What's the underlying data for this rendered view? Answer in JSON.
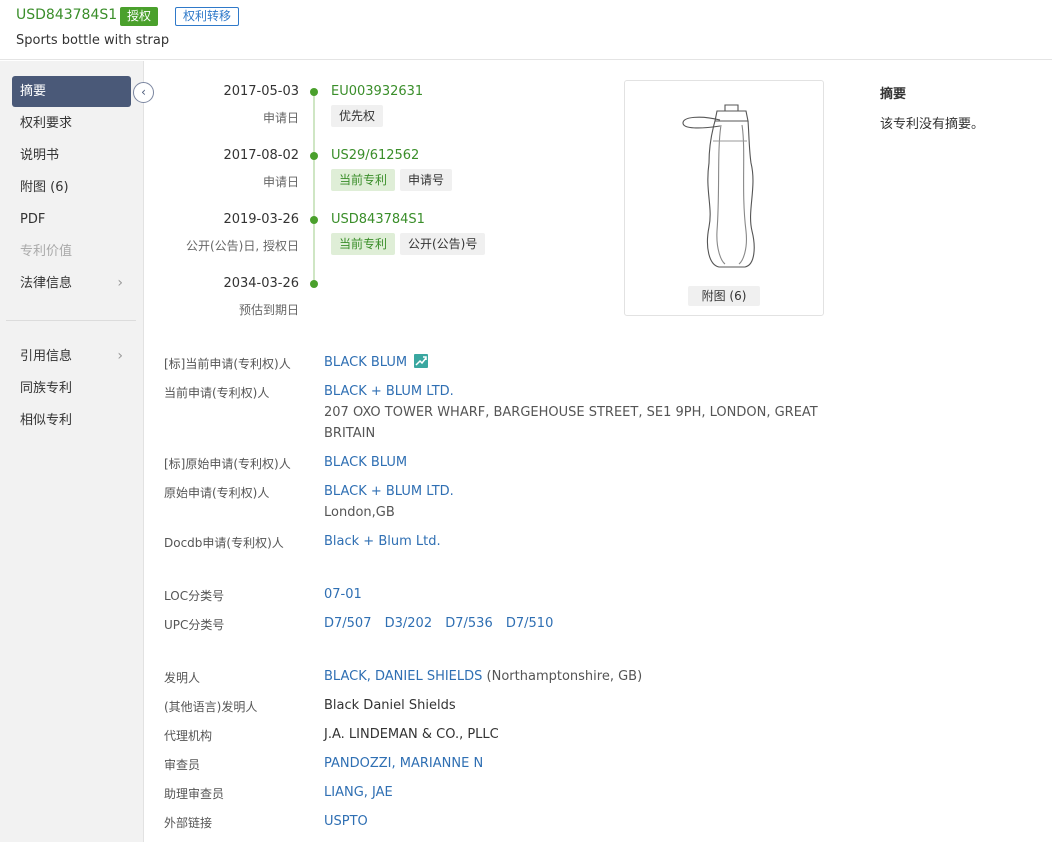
{
  "header": {
    "patent_number": "USD843784S1",
    "status_badge": "授权",
    "transfer_badge": "权利转移",
    "title": "Sports bottle with strap"
  },
  "sidebar": {
    "items": [
      {
        "label": "摘要",
        "active": true
      },
      {
        "label": "权利要求"
      },
      {
        "label": "说明书"
      },
      {
        "label": "附图 (6)"
      },
      {
        "label": "PDF"
      },
      {
        "label": "专利价值",
        "disabled": true
      },
      {
        "label": "法律信息",
        "arrow": "›"
      }
    ],
    "items2": [
      {
        "label": "引用信息",
        "arrow": "›"
      },
      {
        "label": "同族专利"
      },
      {
        "label": "相似专利"
      }
    ],
    "collapse_icon": "‹"
  },
  "timeline": [
    {
      "date": "2017-05-03",
      "label": "申请日",
      "number": "EU003932631",
      "tags": [
        {
          "text": "优先权",
          "style": "gray"
        }
      ]
    },
    {
      "date": "2017-08-02",
      "label": "申请日",
      "number": "US29/612562",
      "tags": [
        {
          "text": "当前专利",
          "style": "green"
        },
        {
          "text": "申请号",
          "style": "gray"
        }
      ]
    },
    {
      "date": "2019-03-26",
      "label": "公开(公告)日, 授权日",
      "number": "USD843784S1",
      "tags": [
        {
          "text": "当前专利",
          "style": "green"
        },
        {
          "text": "公开(公告)号",
          "style": "gray"
        }
      ]
    },
    {
      "date": "2034-03-26",
      "label": "预估到期日",
      "number": "",
      "tags": []
    }
  ],
  "image_panel": {
    "caption": "附图 (6)"
  },
  "abstract": {
    "title": "摘要",
    "text": "该专利没有摘要。"
  },
  "fields": {
    "std_current_applicant": {
      "label": "[标]当前申请(专利权)人",
      "value": "BLACK BLUM"
    },
    "current_applicant": {
      "label": "当前申请(专利权)人",
      "value": "BLACK + BLUM LTD.",
      "address_line1": "207 OXO TOWER WHARF, BARGEHOUSE STREET, SE1 9PH, LONDON, GREAT",
      "address_line2": "BRITAIN"
    },
    "std_original_applicant": {
      "label": "[标]原始申请(专利权)人",
      "value": "BLACK BLUM"
    },
    "original_applicant": {
      "label": "原始申请(专利权)人",
      "value": "BLACK + BLUM LTD.",
      "address": "London,GB"
    },
    "docdb_applicant": {
      "label": "Docdb申请(专利权)人",
      "value": "Black + Blum Ltd."
    },
    "loc": {
      "label": "LOC分类号",
      "value": "07-01"
    },
    "upc": {
      "label": "UPC分类号",
      "values": [
        "D7/507",
        "D3/202",
        "D7/536",
        "D7/510"
      ]
    },
    "inventor": {
      "label": "发明人",
      "value": "BLACK, DANIEL SHIELDS",
      "location": "(Northamptonshire, GB)"
    },
    "inventor_other": {
      "label": "(其他语言)发明人",
      "value": "Black Daniel Shields"
    },
    "agency": {
      "label": "代理机构",
      "value": "J.A. LINDEMAN & CO., PLLC"
    },
    "examiner": {
      "label": "审查员",
      "value": "PANDOZZI, MARIANNE N"
    },
    "assistant_examiner": {
      "label": "助理审查员",
      "value": "LIANG, JAE"
    },
    "external_link": {
      "label": "外部链接",
      "value": "USPTO"
    }
  },
  "colors": {
    "green": "#4aa02c",
    "link": "#2f6fb3",
    "sidebar_active": "#4a5978"
  }
}
